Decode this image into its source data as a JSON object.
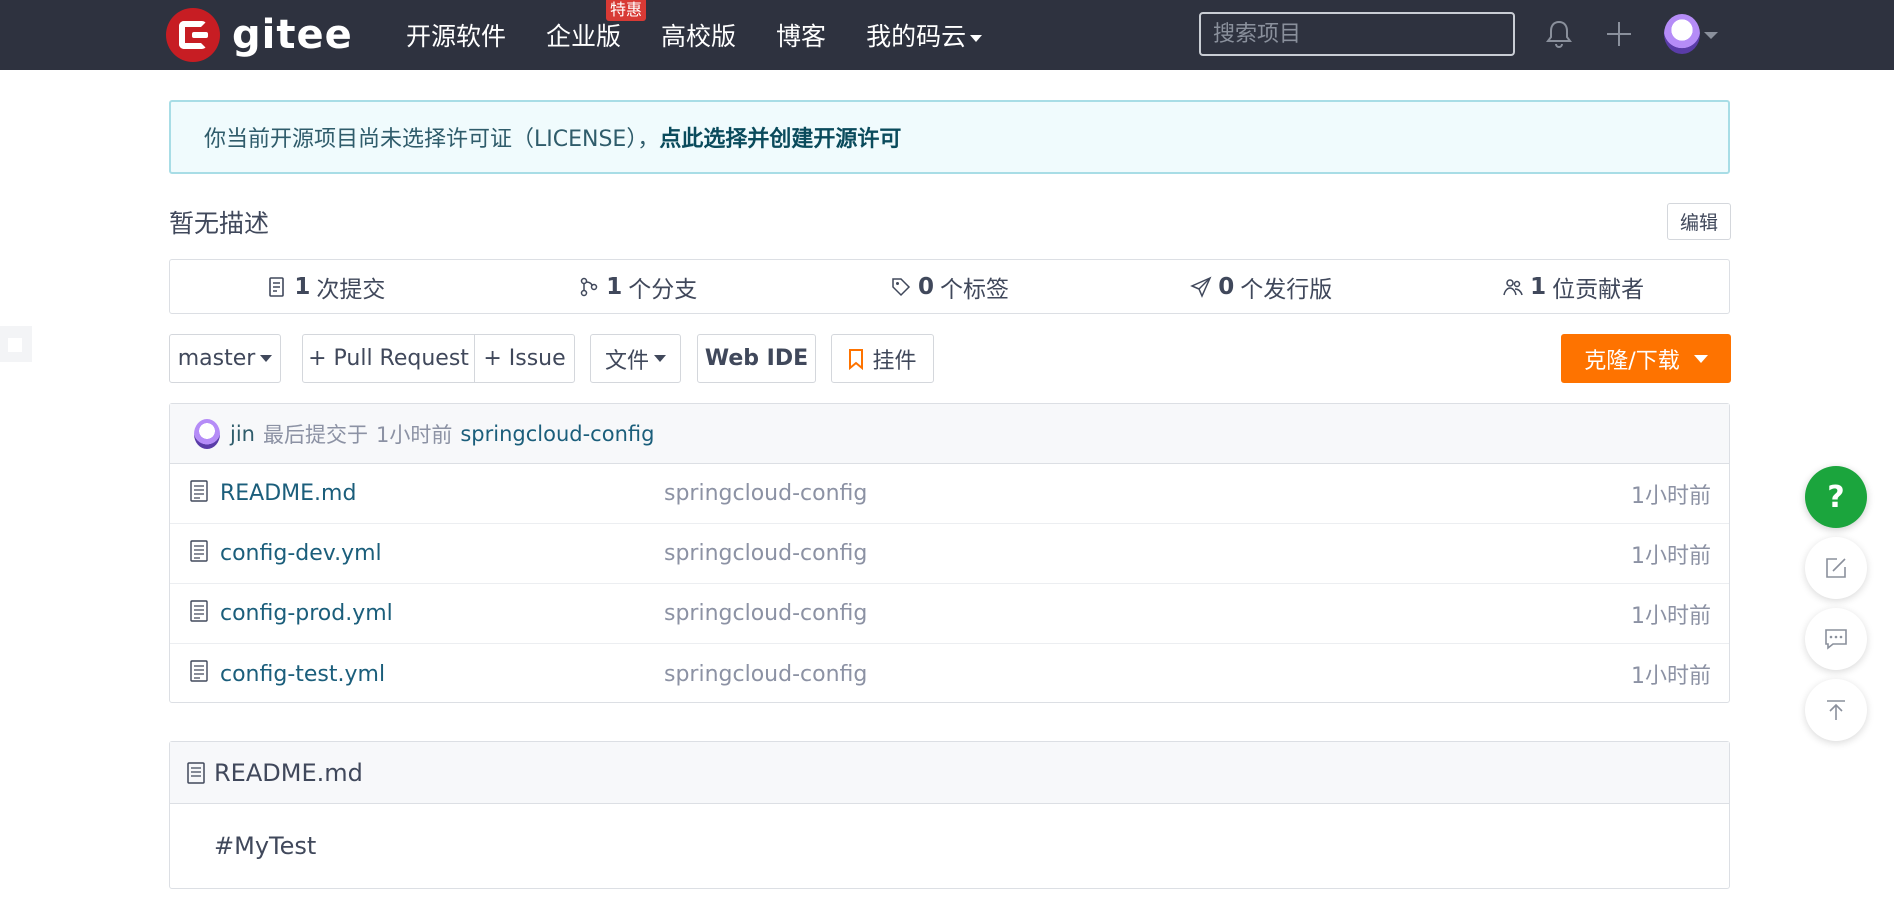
{
  "header": {
    "logo_text": "gitee",
    "nav": [
      {
        "label": "开源软件"
      },
      {
        "label": "企业版",
        "badge": "特惠"
      },
      {
        "label": "高校版"
      },
      {
        "label": "博客"
      },
      {
        "label": "我的码云"
      }
    ],
    "search_placeholder": "搜索项目"
  },
  "license_banner": {
    "text": "你当前开源项目尚未选择许可证（LICENSE），",
    "link": "点此选择并创建开源许可"
  },
  "description": "暂无描述",
  "edit_label": "编辑",
  "stats": [
    {
      "icon": "commit-icon",
      "count": "1",
      "label": "次提交"
    },
    {
      "icon": "branch-icon",
      "count": "1",
      "label": "个分支"
    },
    {
      "icon": "tag-icon",
      "count": "0",
      "label": "个标签"
    },
    {
      "icon": "release-icon",
      "count": "0",
      "label": "个发行版"
    },
    {
      "icon": "contributors-icon",
      "count": "1",
      "label": "位贡献者"
    }
  ],
  "toolbar": {
    "branch": "master",
    "pull_request": "+ Pull Request",
    "issue": "+ Issue",
    "file": "文件",
    "web_ide": "Web IDE",
    "widget": "挂件",
    "clone": "克隆/下载"
  },
  "last_commit": {
    "author": "jin",
    "label": "最后提交于",
    "time": "1小时前",
    "message": "springcloud-config"
  },
  "files": [
    {
      "name": "README.md",
      "message": "springcloud-config",
      "time": "1小时前"
    },
    {
      "name": "config-dev.yml",
      "message": "springcloud-config",
      "time": "1小时前"
    },
    {
      "name": "config-prod.yml",
      "message": "springcloud-config",
      "time": "1小时前"
    },
    {
      "name": "config-test.yml",
      "message": "springcloud-config",
      "time": "1小时前"
    }
  ],
  "readme": {
    "title": "README.md",
    "content": "#MyTest"
  },
  "floating": {
    "help": "?"
  },
  "colors": {
    "topbar": "#2e323f",
    "brand_red": "#c71d23",
    "clone_orange": "#fe7300",
    "help_green": "#1ba53d",
    "link": "#1b5e7b"
  }
}
